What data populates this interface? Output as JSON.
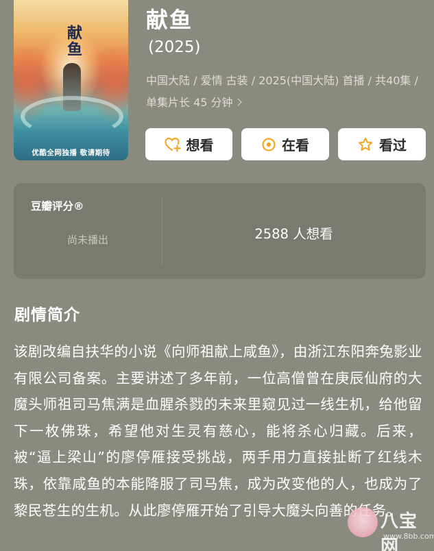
{
  "poster": {
    "title_art": "献鱼",
    "caption": "优酷全网独播 敬请期待"
  },
  "show": {
    "title": "献鱼",
    "year": "(2025)",
    "meta": "中国大陆 / 爱情 古装 / 2025(中国大陆) 首播 / 共40集 / 单集片长 45 分钟"
  },
  "actions": {
    "want": "想看",
    "watching": "在看",
    "watched": "看过"
  },
  "rating": {
    "label": "豆瓣评分®",
    "status": "尚未播出",
    "want_count": "2588 人想看"
  },
  "synopsis": {
    "heading": "剧情简介",
    "text": "该剧改编自扶华的小说《向师祖献上咸鱼》，由浙江东阳奔兔影业有限公司备案。主要讲述了多年前，一位高僧曾在庚辰仙府的大魔头师祖司马焦满是血腥杀戮的未来里窥见过一线生机，给他留下一枚佛珠，希望他对生灵有慈心，能将杀心归藏。后来，被“逼上梁山”的廖停雁接受挑战，两手用力直接扯断了红线木珠，依靠咸鱼的本能降服了司马焦，成为改变他的人，也成为了黎民苍生的生机。从此廖停雁开始了引导大魔头向善的任务。"
  },
  "watermark": {
    "brand": "八宝网",
    "url": "www.8bb.com"
  },
  "colors": {
    "background": "#8a8a7e",
    "card": "#7a7a6f",
    "button": "#ffffff",
    "accent_orange": "#f5a623"
  }
}
